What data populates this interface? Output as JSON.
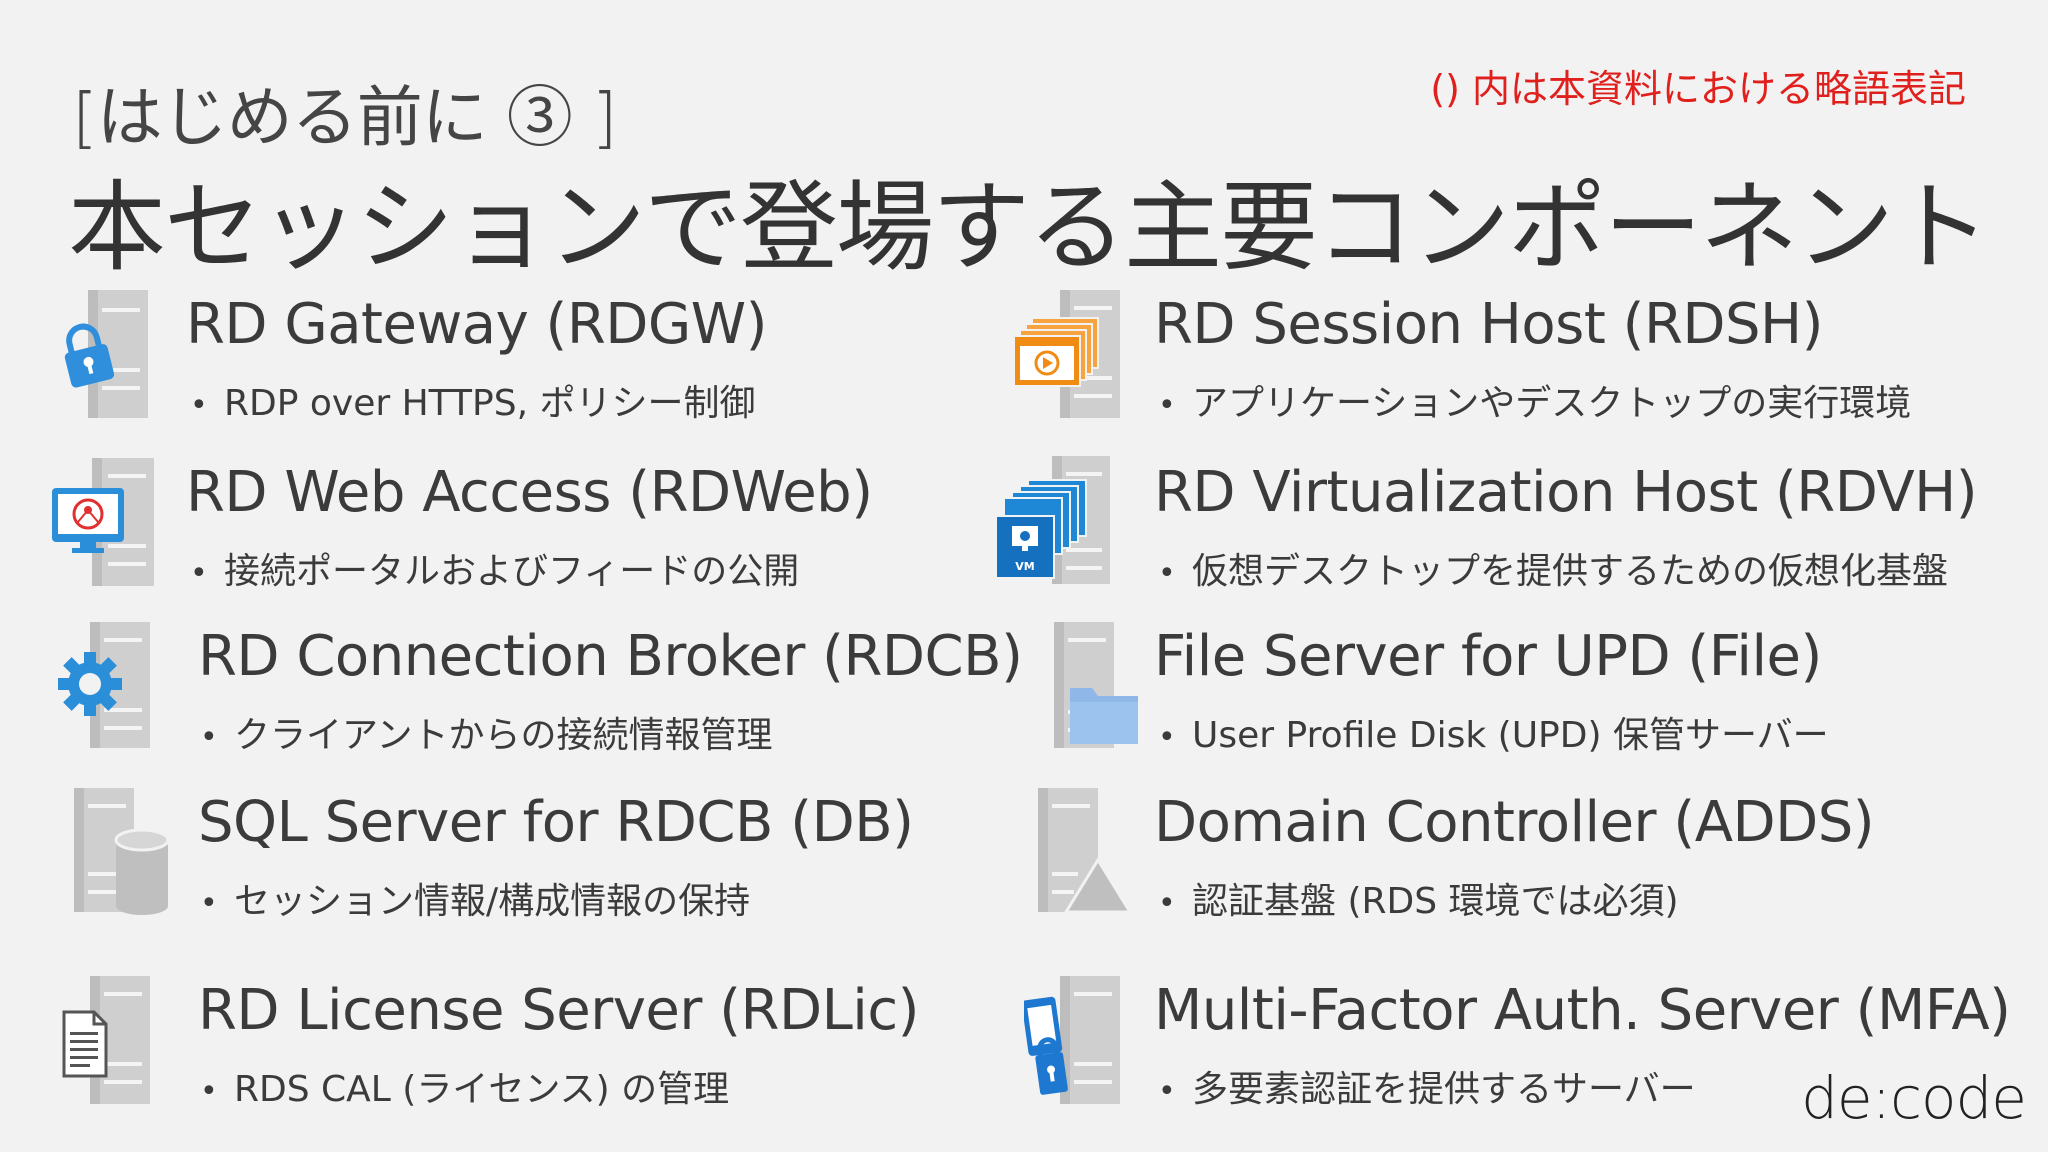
{
  "slide": {
    "subtitle": "[はじめる前に ③ ]",
    "note": "() 内は本資料における略語表記",
    "title": "本セッションで登場する主要コンポーネント",
    "logo": "de:code"
  },
  "components": [
    {
      "name": "RD Gateway (RDGW)",
      "desc": "RDP over HTTPS, ポリシー制御",
      "icon": "gateway-lock-icon"
    },
    {
      "name": "RD Web Access (RDWeb)",
      "desc": "接続ポータルおよびフィードの公開",
      "icon": "web-access-monitor-icon"
    },
    {
      "name": "RD Connection Broker (RDCB)",
      "desc": "クライアントからの接続情報管理",
      "icon": "broker-gear-icon"
    },
    {
      "name": "SQL Server for RDCB (DB)",
      "desc": "セッション情報/構成情報の保持",
      "icon": "database-icon"
    },
    {
      "name": "RD License Server (RDLic)",
      "desc": "RDS CAL (ライセンス) の管理",
      "icon": "license-document-icon"
    },
    {
      "name": "RD Session Host (RDSH)",
      "desc": "アプリケーションやデスクトップの実行環境",
      "icon": "session-windows-icon"
    },
    {
      "name": "RD Virtualization Host (RDVH)",
      "desc": "仮想デスクトップを提供するための仮想化基盤",
      "icon": "virtual-machine-icon"
    },
    {
      "name": "File Server for UPD (File)",
      "desc": "User Profile Disk (UPD) 保管サーバー",
      "icon": "folder-icon"
    },
    {
      "name": "Domain Controller (ADDS)",
      "desc": "認証基盤 (RDS 環境では必須)",
      "icon": "domain-pyramid-icon"
    },
    {
      "name": "Multi-Factor Auth. Server (MFA)",
      "desc": "多要素認証を提供するサーバー",
      "icon": "mfa-phone-lock-icon"
    }
  ],
  "colors": {
    "accent_red": "#e0201d",
    "server_gray": "#c8c8c8",
    "icon_blue": "#1e88d6",
    "icon_orange": "#f08c14"
  }
}
